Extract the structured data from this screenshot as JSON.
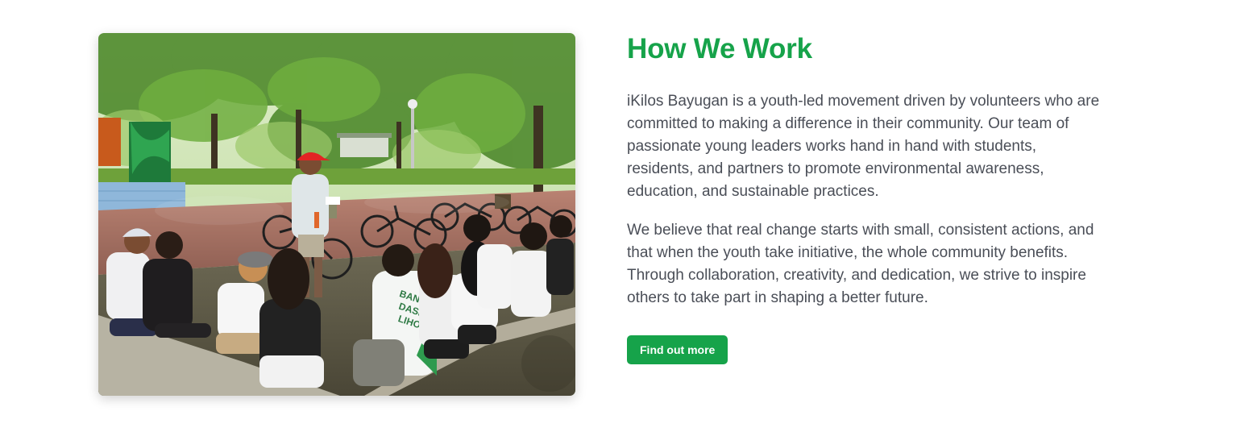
{
  "section": {
    "title": "How We Work",
    "paragraphs": [
      "iKilos Bayugan is a youth-led movement driven by volunteers who are committed to making a difference in their community. Our team of passionate young leaders works hand in hand with students, residents, and partners to promote environmental awareness, education, and sustainable practices.",
      "We believe that real change starts with small, consistent actions, and that when the youth take initiative, the whole community benefits. Through collaboration, creativity, and dedication, we strive to inspire others to take part in shaping a better future."
    ],
    "button_label": "Find out more"
  },
  "photo": {
    "shirt_text": [
      "BANGON",
      "DASIG",
      "LIHOK"
    ]
  },
  "colors": {
    "accent": "#16a34a",
    "body_text": "#4a4e57",
    "button_text": "#ffffff"
  }
}
